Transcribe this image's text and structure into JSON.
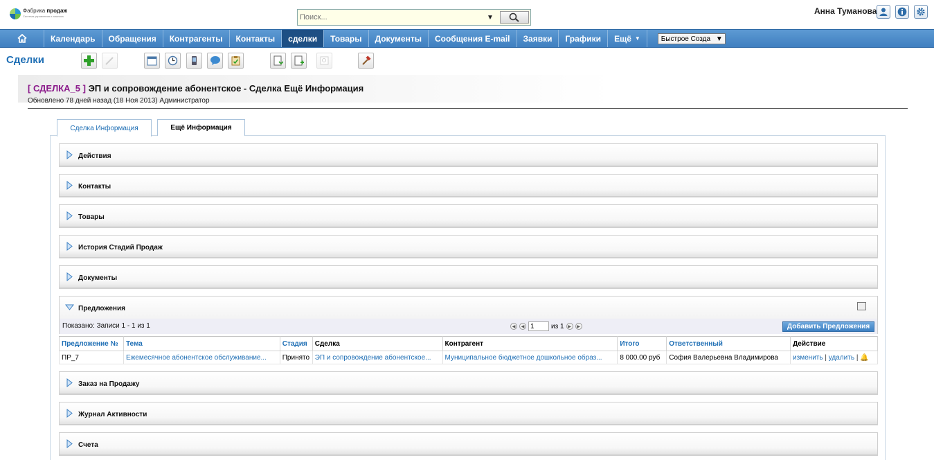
{
  "header": {
    "logo_brand": "Фабрика",
    "logo_brand_bold": "продаж",
    "logo_tagline": "Система управления и анализа",
    "search_placeholder": "Поиск...",
    "user_name": "Анна Туманова"
  },
  "nav": {
    "items": [
      {
        "label": "Календарь",
        "active": false
      },
      {
        "label": "Обращения",
        "active": false
      },
      {
        "label": "Контрагенты",
        "active": false
      },
      {
        "label": "Контакты",
        "active": false
      },
      {
        "label": "сделки",
        "active": true
      },
      {
        "label": "Товары",
        "active": false
      },
      {
        "label": "Документы",
        "active": false
      },
      {
        "label": "Сообщения E-mail",
        "active": false
      },
      {
        "label": "Заявки",
        "active": false
      },
      {
        "label": "Графики",
        "active": false
      }
    ],
    "more_label": "Ещё",
    "quick_create_label": "Быстрое Созда"
  },
  "toolbar": {
    "module_title": "Сделки"
  },
  "record": {
    "id_label": "[ СДЕЛКА_5 ]",
    "title": "ЭП и сопровождение абонентское - Сделка Ещё Информация",
    "updated": "Обновлено 78 дней назад (18 Ноя 2013) Администратор"
  },
  "tabs": [
    {
      "label": "Сделка Информация",
      "active": false
    },
    {
      "label": "Ещё Информация",
      "active": true
    }
  ],
  "panels_top": [
    {
      "label": "Действия"
    },
    {
      "label": "Контакты"
    },
    {
      "label": "Товары"
    },
    {
      "label": "История Стадий Продаж"
    },
    {
      "label": "Документы"
    }
  ],
  "proposals": {
    "title": "Предложения",
    "shown_text": "Показано: Записи 1 - 1 из 1",
    "page_value": "1",
    "page_of": "из 1",
    "add_button": "Добавить Предложения",
    "columns": [
      "Предложение №",
      "Тема",
      "Стадия",
      "Сделка",
      "Контрагент",
      "Итого",
      "Ответственный",
      "Действие"
    ],
    "rows": [
      {
        "number": "ПР_7",
        "topic": "Ежемесячное абонентское обслуживание...",
        "stage": "Принято",
        "deal": "ЭП и сопровождение абонентское...",
        "account": "Муниципальное бюджетное дошкольное образ...",
        "total": "8 000.00 руб",
        "owner": "София Валерьевна Владимирова",
        "edit": "изменить",
        "delete": "удалить"
      }
    ]
  },
  "panels_bottom": [
    {
      "label": "Заказ на Продажу"
    },
    {
      "label": "Журнал Активности"
    },
    {
      "label": "Счета"
    }
  ],
  "colors": {
    "nav_bg": "#4a89c8",
    "nav_active": "#1d4f84",
    "link": "#1f6fb5",
    "record_id": "#8b1a8b"
  }
}
